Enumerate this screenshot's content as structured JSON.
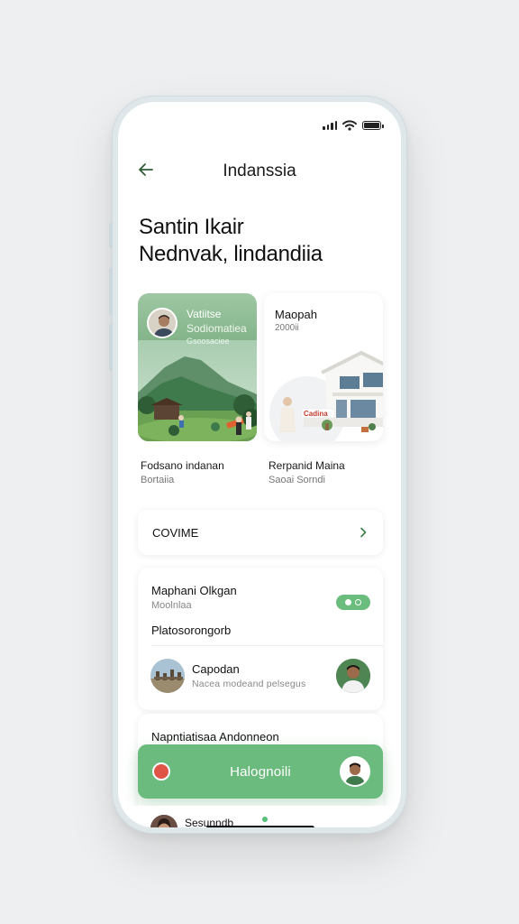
{
  "nav": {
    "title": "Indanssia",
    "back_icon": "arrow-left-icon"
  },
  "headline": {
    "line1": "Santin Ikair",
    "line2": "Nednvak, lindandiia"
  },
  "cards": [
    {
      "title": "Vatiitse",
      "subtitle": "Sodiomatiea",
      "tag": "Gsoosaciee",
      "caption_title": "Fodsano indanan",
      "caption_sub": "Bortaiia"
    },
    {
      "title": "Maopah",
      "subtitle": "2000ii",
      "sign": "Cadina",
      "caption_title": "Rerpanid Maina",
      "caption_sub": "Saoai Sorndi"
    }
  ],
  "combo": {
    "label": "COVIME"
  },
  "panel": {
    "title": "Maphani Olkgan",
    "subtitle": "Moolnlaa",
    "toggle_on": true,
    "heading": "Platosorongorb",
    "row": {
      "title": "Capodan",
      "subtitle": "Nacea modeand pelsegus"
    }
  },
  "panel2": {
    "title": "Napntiatisaa Andonneon"
  },
  "cta": {
    "label": "Halognoili"
  },
  "bottom": {
    "text": "Sesunndb"
  },
  "colors": {
    "accent": "#6cbb7e",
    "record": "#e05447",
    "icon": "#2e5e36"
  }
}
